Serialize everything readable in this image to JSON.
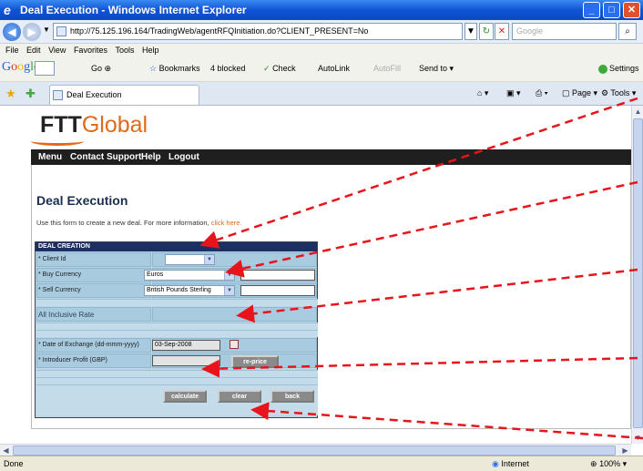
{
  "window": {
    "title": "Deal Execution - Windows Internet Explorer"
  },
  "address": {
    "url": "http://75.125.196.164/TradingWeb/agentRFQInitiation.do?CLIENT_PRESENT=No",
    "search_placeholder": "Google"
  },
  "menubar": {
    "items": [
      "File",
      "Edit",
      "View",
      "Favorites",
      "Tools",
      "Help"
    ]
  },
  "google_toolbar": {
    "logo": "Google",
    "go": "Go",
    "bookmarks": "Bookmarks",
    "blocked": "4 blocked",
    "check": "Check",
    "autolink": "AutoLink",
    "autofill": "AutoFill",
    "sendto": "Send to",
    "settings": "Settings"
  },
  "tab": {
    "title": "Deal Execution"
  },
  "commandbar": {
    "page": "Page",
    "tools": "Tools"
  },
  "site": {
    "logo_ftt": "FTT",
    "logo_global": "Global",
    "nav": [
      "Menu",
      "Contact Support",
      "Help",
      "Logout"
    ]
  },
  "page": {
    "heading": "Deal Execution",
    "intro": "Use this form to create a new deal. For more information,",
    "intro_link": "click here."
  },
  "form": {
    "header": "DEAL CREATION",
    "client_id_label": "* Client Id",
    "client_id_value": "",
    "buy_currency_label": "* Buy Currency",
    "buy_currency_value": "Euros",
    "sell_currency_label": "* Sell Currency",
    "sell_currency_value": "British Pounds Sterling",
    "rate_label": "All Inclusive Rate",
    "date_label": "* Date of Exchange (dd-mmm-yyyy)",
    "date_value": "03-Sep-2008",
    "profit_label": "* Introducer Profit (GBP)",
    "reprice_label": "re-price",
    "calculate_label": "calculate",
    "clear_label": "clear",
    "back_label": "back"
  },
  "statusbar": {
    "left": "Done",
    "zone": "Internet",
    "zoom": "100%"
  },
  "annotation_color": "#e8141b"
}
